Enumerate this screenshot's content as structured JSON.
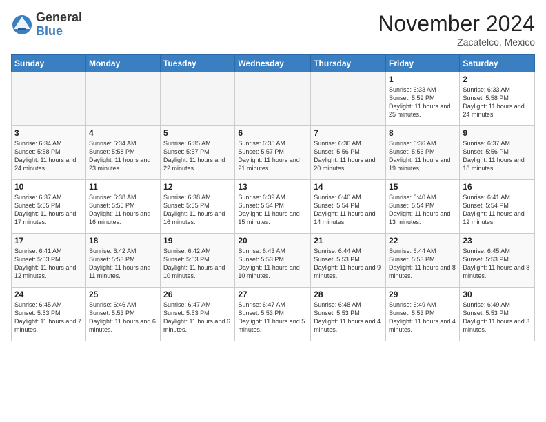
{
  "logo": {
    "general": "General",
    "blue": "Blue"
  },
  "title": "November 2024",
  "location": "Zacatelco, Mexico",
  "weekdays": [
    "Sunday",
    "Monday",
    "Tuesday",
    "Wednesday",
    "Thursday",
    "Friday",
    "Saturday"
  ],
  "weeks": [
    [
      {
        "day": "",
        "info": ""
      },
      {
        "day": "",
        "info": ""
      },
      {
        "day": "",
        "info": ""
      },
      {
        "day": "",
        "info": ""
      },
      {
        "day": "",
        "info": ""
      },
      {
        "day": "1",
        "info": "Sunrise: 6:33 AM\nSunset: 5:59 PM\nDaylight: 11 hours\nand 25 minutes."
      },
      {
        "day": "2",
        "info": "Sunrise: 6:33 AM\nSunset: 5:58 PM\nDaylight: 11 hours\nand 24 minutes."
      }
    ],
    [
      {
        "day": "3",
        "info": "Sunrise: 6:34 AM\nSunset: 5:58 PM\nDaylight: 11 hours\nand 24 minutes."
      },
      {
        "day": "4",
        "info": "Sunrise: 6:34 AM\nSunset: 5:58 PM\nDaylight: 11 hours\nand 23 minutes."
      },
      {
        "day": "5",
        "info": "Sunrise: 6:35 AM\nSunset: 5:57 PM\nDaylight: 11 hours\nand 22 minutes."
      },
      {
        "day": "6",
        "info": "Sunrise: 6:35 AM\nSunset: 5:57 PM\nDaylight: 11 hours\nand 21 minutes."
      },
      {
        "day": "7",
        "info": "Sunrise: 6:36 AM\nSunset: 5:56 PM\nDaylight: 11 hours\nand 20 minutes."
      },
      {
        "day": "8",
        "info": "Sunrise: 6:36 AM\nSunset: 5:56 PM\nDaylight: 11 hours\nand 19 minutes."
      },
      {
        "day": "9",
        "info": "Sunrise: 6:37 AM\nSunset: 5:56 PM\nDaylight: 11 hours\nand 18 minutes."
      }
    ],
    [
      {
        "day": "10",
        "info": "Sunrise: 6:37 AM\nSunset: 5:55 PM\nDaylight: 11 hours\nand 17 minutes."
      },
      {
        "day": "11",
        "info": "Sunrise: 6:38 AM\nSunset: 5:55 PM\nDaylight: 11 hours\nand 16 minutes."
      },
      {
        "day": "12",
        "info": "Sunrise: 6:38 AM\nSunset: 5:55 PM\nDaylight: 11 hours\nand 16 minutes."
      },
      {
        "day": "13",
        "info": "Sunrise: 6:39 AM\nSunset: 5:54 PM\nDaylight: 11 hours\nand 15 minutes."
      },
      {
        "day": "14",
        "info": "Sunrise: 6:40 AM\nSunset: 5:54 PM\nDaylight: 11 hours\nand 14 minutes."
      },
      {
        "day": "15",
        "info": "Sunrise: 6:40 AM\nSunset: 5:54 PM\nDaylight: 11 hours\nand 13 minutes."
      },
      {
        "day": "16",
        "info": "Sunrise: 6:41 AM\nSunset: 5:54 PM\nDaylight: 11 hours\nand 12 minutes."
      }
    ],
    [
      {
        "day": "17",
        "info": "Sunrise: 6:41 AM\nSunset: 5:53 PM\nDaylight: 11 hours\nand 12 minutes."
      },
      {
        "day": "18",
        "info": "Sunrise: 6:42 AM\nSunset: 5:53 PM\nDaylight: 11 hours\nand 11 minutes."
      },
      {
        "day": "19",
        "info": "Sunrise: 6:42 AM\nSunset: 5:53 PM\nDaylight: 11 hours\nand 10 minutes."
      },
      {
        "day": "20",
        "info": "Sunrise: 6:43 AM\nSunset: 5:53 PM\nDaylight: 11 hours\nand 10 minutes."
      },
      {
        "day": "21",
        "info": "Sunrise: 6:44 AM\nSunset: 5:53 PM\nDaylight: 11 hours\nand 9 minutes."
      },
      {
        "day": "22",
        "info": "Sunrise: 6:44 AM\nSunset: 5:53 PM\nDaylight: 11 hours\nand 8 minutes."
      },
      {
        "day": "23",
        "info": "Sunrise: 6:45 AM\nSunset: 5:53 PM\nDaylight: 11 hours\nand 8 minutes."
      }
    ],
    [
      {
        "day": "24",
        "info": "Sunrise: 6:45 AM\nSunset: 5:53 PM\nDaylight: 11 hours\nand 7 minutes."
      },
      {
        "day": "25",
        "info": "Sunrise: 6:46 AM\nSunset: 5:53 PM\nDaylight: 11 hours\nand 6 minutes."
      },
      {
        "day": "26",
        "info": "Sunrise: 6:47 AM\nSunset: 5:53 PM\nDaylight: 11 hours\nand 6 minutes."
      },
      {
        "day": "27",
        "info": "Sunrise: 6:47 AM\nSunset: 5:53 PM\nDaylight: 11 hours\nand 5 minutes."
      },
      {
        "day": "28",
        "info": "Sunrise: 6:48 AM\nSunset: 5:53 PM\nDaylight: 11 hours\nand 4 minutes."
      },
      {
        "day": "29",
        "info": "Sunrise: 6:49 AM\nSunset: 5:53 PM\nDaylight: 11 hours\nand 4 minutes."
      },
      {
        "day": "30",
        "info": "Sunrise: 6:49 AM\nSunset: 5:53 PM\nDaylight: 11 hours\nand 3 minutes."
      }
    ]
  ]
}
